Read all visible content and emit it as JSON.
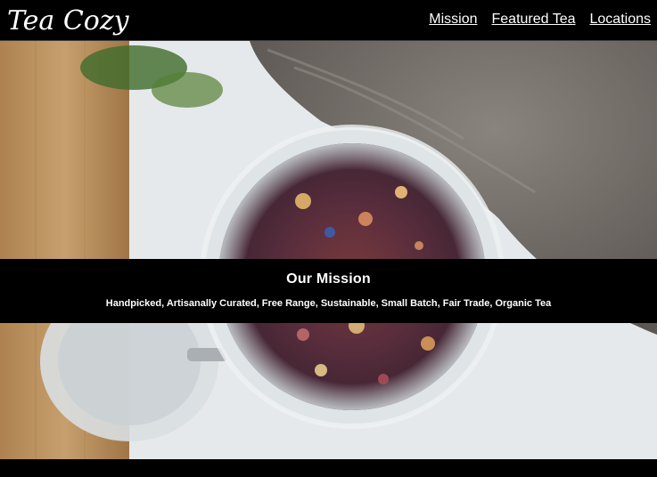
{
  "header": {
    "logo_text": "Tea Cozy",
    "nav": [
      {
        "label": "Mission"
      },
      {
        "label": "Featured Tea"
      },
      {
        "label": "Locations"
      }
    ]
  },
  "hero": {
    "image": "tea-jar-photo"
  },
  "mission": {
    "title": "Our Mission",
    "text": "Handpicked, Artisanally Curated, Free Range, Sustainable, Small Batch, Fair Trade, Organic Tea"
  },
  "colors": {
    "background": "#000000",
    "text": "#ffffff"
  }
}
